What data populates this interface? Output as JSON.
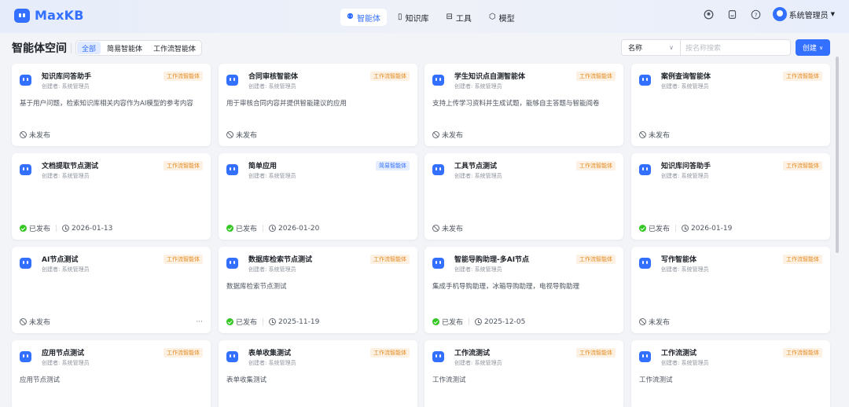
{
  "app": {
    "name": "MaxKB"
  },
  "nav": [
    {
      "label": "智能体",
      "icon": "robot-icon",
      "glyph": "⚉",
      "active": true
    },
    {
      "label": "知识库",
      "icon": "book-icon",
      "glyph": "▯",
      "active": false
    },
    {
      "label": "工具",
      "icon": "toolbox-icon",
      "glyph": "⊟",
      "active": false
    },
    {
      "label": "模型",
      "icon": "cube-icon",
      "glyph": "⬡",
      "active": false
    }
  ],
  "user": {
    "name": "系统管理员"
  },
  "workspace": {
    "title": "智能体空间",
    "filters": [
      "全部",
      "简易智能体",
      "工作流智能体"
    ],
    "active_filter": "全部",
    "search_field": "名称",
    "search_placeholder": "按名称搜索",
    "create_label": "创建"
  },
  "creator_prefix": "创建者: 系统管理员",
  "cards": [
    {
      "name": "知识库问答助手",
      "tag": "工作流智能体",
      "tag_type": "workflow",
      "desc": "基于用户问题，检索知识库相关内容作为AI模型的参考内容",
      "status": "未发布",
      "published": false,
      "date": ""
    },
    {
      "name": "合同审核智能体",
      "tag": "工作流智能体",
      "tag_type": "workflow",
      "desc": "用于审核合同内容并提供智能建议的应用",
      "status": "未发布",
      "published": false,
      "date": ""
    },
    {
      "name": "学生知识点自测智能体",
      "tag": "工作流智能体",
      "tag_type": "workflow",
      "desc": "支持上传学习资料并生成试题，能够自主答题与智能阅卷",
      "status": "未发布",
      "published": false,
      "date": ""
    },
    {
      "name": "案例查询智能体",
      "tag": "工作流智能体",
      "tag_type": "workflow",
      "desc": "",
      "status": "未发布",
      "published": false,
      "date": ""
    },
    {
      "name": "文档提取节点测试",
      "tag": "工作流智能体",
      "tag_type": "workflow",
      "desc": "",
      "status": "已发布",
      "published": true,
      "date": "2026-01-13"
    },
    {
      "name": "简单应用",
      "tag": "简易智能体",
      "tag_type": "simple",
      "desc": "",
      "status": "已发布",
      "published": true,
      "date": "2026-01-20"
    },
    {
      "name": "工具节点测试",
      "tag": "工作流智能体",
      "tag_type": "workflow",
      "desc": "",
      "status": "未发布",
      "published": false,
      "date": ""
    },
    {
      "name": "知识库问答助手",
      "tag": "工作流智能体",
      "tag_type": "workflow",
      "desc": "",
      "status": "已发布",
      "published": true,
      "date": "2026-01-19"
    },
    {
      "name": "AI节点测试",
      "tag": "工作流智能体",
      "tag_type": "workflow",
      "desc": "",
      "status": "未发布",
      "published": false,
      "date": "",
      "more": "···"
    },
    {
      "name": "数据库检索节点测试",
      "tag": "工作流智能体",
      "tag_type": "workflow",
      "desc": "数据库检索节点测试",
      "status": "已发布",
      "published": true,
      "date": "2025-11-19"
    },
    {
      "name": "智能导购助理-多AI节点",
      "tag": "工作流智能体",
      "tag_type": "workflow",
      "desc": "集成手机导购助理，冰箱导购助理，电视导购助理",
      "status": "已发布",
      "published": true,
      "date": "2025-12-05"
    },
    {
      "name": "写作智能体",
      "tag": "工作流智能体",
      "tag_type": "workflow",
      "desc": "",
      "status": "未发布",
      "published": false,
      "date": ""
    },
    {
      "name": "应用节点测试",
      "tag": "工作流智能体",
      "tag_type": "workflow",
      "desc": "应用节点测试",
      "status": "",
      "published": false,
      "date": ""
    },
    {
      "name": "表单收集测试",
      "tag": "工作流智能体",
      "tag_type": "workflow",
      "desc": "表单收集测试",
      "status": "",
      "published": false,
      "date": ""
    },
    {
      "name": "工作流测试",
      "tag": "工作流智能体",
      "tag_type": "workflow",
      "desc": "工作流测试",
      "status": "",
      "published": false,
      "date": ""
    },
    {
      "name": "工作流测试",
      "tag": "工作流智能体",
      "tag_type": "workflow",
      "desc": "工作流测试",
      "status": "",
      "published": false,
      "date": ""
    }
  ],
  "colors": {
    "accent": "#3370ff",
    "workflow_tag": "#e38a1f",
    "published": "#34c724"
  }
}
